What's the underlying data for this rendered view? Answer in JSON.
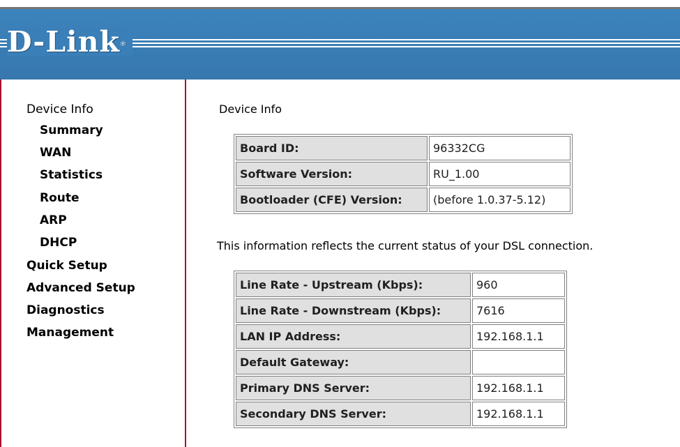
{
  "header": {
    "logo": "D-Link",
    "logo_mark": "®"
  },
  "sidebar": {
    "device_info": "Device Info",
    "sub_items": [
      "Summary",
      "WAN",
      "Statistics",
      "Route",
      "ARP",
      "DHCP"
    ],
    "items": [
      "Quick Setup",
      "Advanced Setup",
      "Diagnostics",
      "Management"
    ]
  },
  "main": {
    "heading": "Device Info",
    "device_table": [
      {
        "label": "Board ID:",
        "value": "96332CG"
      },
      {
        "label": "Software Version:",
        "value": "RU_1.00"
      },
      {
        "label": "Bootloader (CFE) Version:",
        "value": "(before 1.0.37-5.12)"
      }
    ],
    "status_note": "This information reflects the current status of your DSL connection.",
    "dsl_table": [
      {
        "label": "Line Rate - Upstream (Kbps):",
        "value": "960"
      },
      {
        "label": "Line Rate - Downstream (Kbps):",
        "value": "7616"
      },
      {
        "label": "LAN IP Address:",
        "value": "192.168.1.1"
      },
      {
        "label": "Default Gateway:",
        "value": ""
      },
      {
        "label": "Primary DNS Server:",
        "value": "192.168.1.1"
      },
      {
        "label": "Secondary DNS Server:",
        "value": "192.168.1.1"
      }
    ]
  },
  "colors": {
    "header_blue": "#3a7fb8",
    "sidebar_border": "#a5112f",
    "label_cell": "#e0e0e0"
  }
}
